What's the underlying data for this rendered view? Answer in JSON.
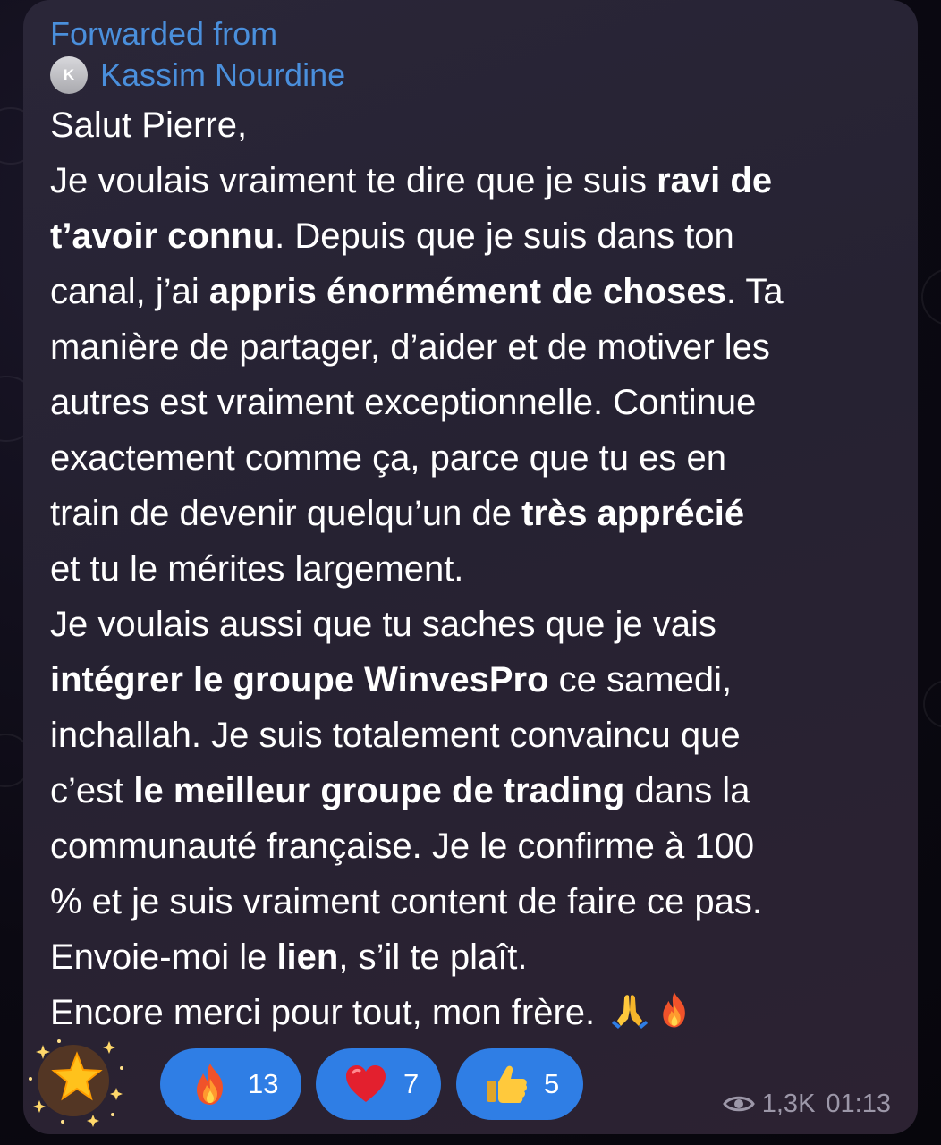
{
  "forwarded": {
    "label": "Forwarded from",
    "sender_initial": "K",
    "sender_name": "Kassim Nourdine"
  },
  "message": {
    "lines": [
      [
        {
          "t": "Salut Pierre,"
        }
      ],
      [
        {
          "t": "Je voulais vraiment te dire que je suis "
        },
        {
          "t": "ravi de",
          "b": true
        }
      ],
      [
        {
          "t": "t’avoir connu",
          "b": true
        },
        {
          "t": ". Depuis que je suis dans ton"
        }
      ],
      [
        {
          "t": "canal, j’ai "
        },
        {
          "t": "appris énormément de choses",
          "b": true
        },
        {
          "t": ". Ta"
        }
      ],
      [
        {
          "t": "manière de partager, d’aider et de motiver les"
        }
      ],
      [
        {
          "t": "autres est vraiment exceptionnelle. Continue"
        }
      ],
      [
        {
          "t": "exactement comme ça, parce que tu es en"
        }
      ],
      [
        {
          "t": "train de devenir quelqu’un de "
        },
        {
          "t": "très apprécié",
          "b": true
        }
      ],
      [
        {
          "t": "et tu le mérites largement."
        }
      ],
      [
        {
          "t": "Je voulais aussi que tu saches que je vais"
        }
      ],
      [
        {
          "t": "intégrer le groupe WinvesPro",
          "b": true
        },
        {
          "t": " ce samedi,"
        }
      ],
      [
        {
          "t": "inchallah. Je suis totalement convaincu que"
        }
      ],
      [
        {
          "t": "c’est "
        },
        {
          "t": "le meilleur groupe de trading",
          "b": true
        },
        {
          "t": " dans la"
        }
      ],
      [
        {
          "t": "communauté française. Je le confirme à 100"
        }
      ],
      [
        {
          "t": "% et je suis vraiment content de faire ce pas."
        }
      ],
      [
        {
          "t": "Envoie-moi le "
        },
        {
          "t": "lien",
          "b": true
        },
        {
          "t": ", s’il te plaît."
        }
      ],
      [
        {
          "t": "Encore merci pour tout, mon frère. "
        },
        {
          "icon": "praying-hands-icon"
        },
        {
          "icon": "fire-icon"
        }
      ]
    ]
  },
  "reactions": {
    "paid_star": {
      "icon": "star-sparkle-icon"
    },
    "items": [
      {
        "icon": "fire-icon",
        "count": "13"
      },
      {
        "icon": "red-heart-icon",
        "count": "7"
      },
      {
        "icon": "thumbs-up-icon",
        "count": "5"
      }
    ]
  },
  "meta": {
    "views": "1,3K",
    "time": "01:13",
    "views_icon": "eye-icon"
  },
  "colors": {
    "link_blue": "#4a8fdc",
    "reaction_blue": "#2f7ee5",
    "bubble": "#272333",
    "meta_gray": "#9c97a8"
  }
}
